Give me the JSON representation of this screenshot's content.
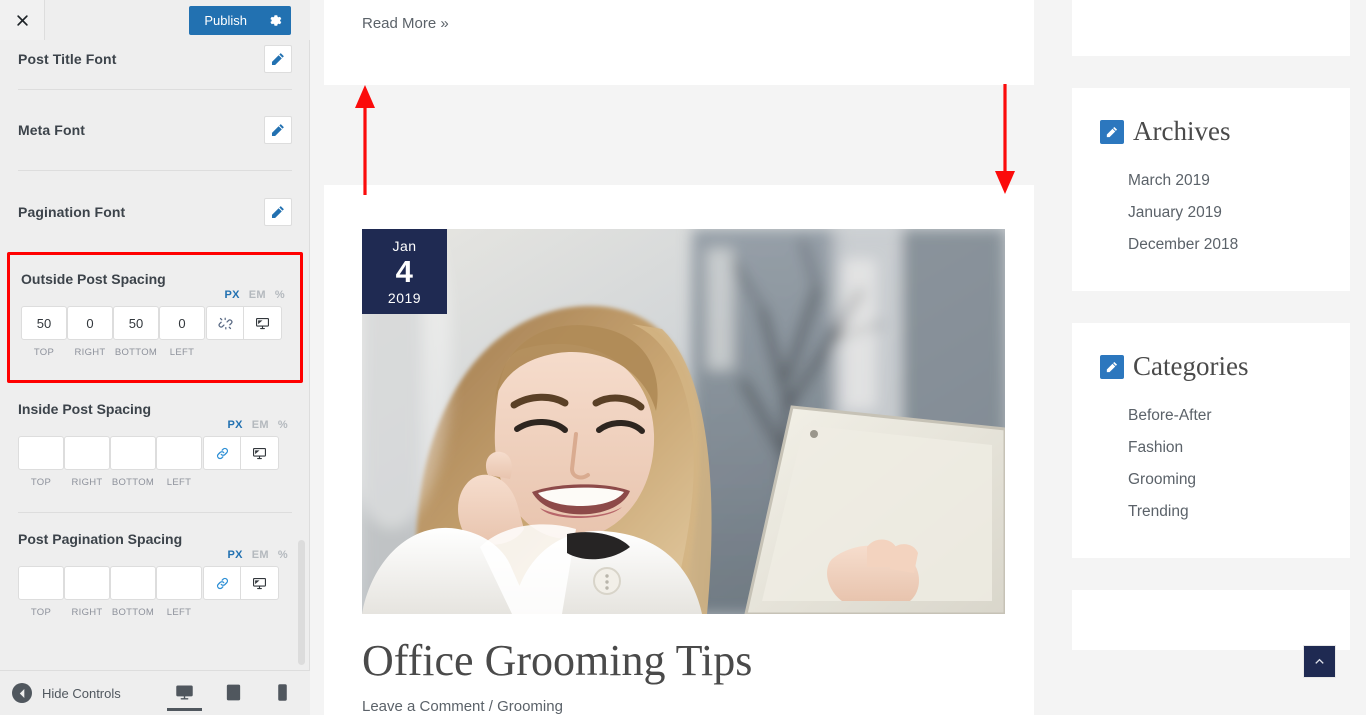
{
  "customizer": {
    "close_label": "Close customizer",
    "publish_label": "Publish",
    "gear_label": "Publish settings",
    "hide_controls_label": "Hide Controls",
    "devices": [
      {
        "name": "desktop",
        "label": "Desktop",
        "active": true
      },
      {
        "name": "tablet",
        "label": "Tablet",
        "active": false
      },
      {
        "name": "mobile",
        "label": "Mobile",
        "active": false
      }
    ],
    "font_rows": [
      {
        "label": "Post Title Font",
        "edit": "edit-icon"
      },
      {
        "label": "Meta Font",
        "edit": "edit-icon"
      },
      {
        "label": "Pagination Font",
        "edit": "edit-icon"
      }
    ],
    "spacing_groups": [
      {
        "title": "Outside Post Spacing",
        "units": [
          "PX",
          "EM",
          "%"
        ],
        "active_unit": "PX",
        "values": {
          "top": "50",
          "right": "0",
          "bottom": "50",
          "left": "0"
        },
        "sub_labels": {
          "top": "TOP",
          "right": "RIGHT",
          "bottom": "BOTTOM",
          "left": "LEFT"
        },
        "link_icon": "broken-link-icon",
        "link_state": "unlinked",
        "device_icon": "monitor-icon",
        "highlighted": true
      },
      {
        "title": "Inside Post Spacing",
        "units": [
          "PX",
          "EM",
          "%"
        ],
        "active_unit": "PX",
        "values": {
          "top": "",
          "right": "",
          "bottom": "",
          "left": ""
        },
        "sub_labels": {
          "top": "TOP",
          "right": "RIGHT",
          "bottom": "BOTTOM",
          "left": "LEFT"
        },
        "link_icon": "link-icon",
        "link_state": "linked",
        "device_icon": "monitor-icon",
        "highlighted": false
      },
      {
        "title": "Post Pagination Spacing",
        "units": [
          "PX",
          "EM",
          "%"
        ],
        "active_unit": "PX",
        "values": {
          "top": "",
          "right": "",
          "bottom": "",
          "left": ""
        },
        "sub_labels": {
          "top": "TOP",
          "right": "RIGHT",
          "bottom": "BOTTOM",
          "left": "LEFT"
        },
        "link_icon": "link-icon",
        "link_state": "linked",
        "device_icon": "monitor-icon",
        "highlighted": false
      }
    ]
  },
  "preview": {
    "previous_post": {
      "read_more_label": "Read More »"
    },
    "post": {
      "date": {
        "month": "Jan",
        "day": "4",
        "year": "2019"
      },
      "title": "Office Grooming Tips",
      "meta": "Leave a Comment / Grooming",
      "featured_image_alt": "Smiling woman in white coat holding a tablet outdoors"
    },
    "sidebar": {
      "widgets": [
        {
          "title": "Archives",
          "edit_icon": "edit-icon",
          "items": [
            "March 2019",
            "January 2019",
            "December 2018"
          ]
        },
        {
          "title": "Categories",
          "edit_icon": "edit-icon",
          "items": [
            "Before-After",
            "Fashion",
            "Grooming",
            "Trending"
          ]
        }
      ]
    },
    "scroll_top_label": "Back to top"
  },
  "annotations": {
    "arrow_up": "red-arrow-up",
    "arrow_down": "red-arrow-down",
    "highlight_box": "red-highlight-box"
  },
  "colors": {
    "accent_blue": "#2271b1",
    "widget_blue": "#2c77be",
    "navy": "#1f2a52",
    "annotation_red": "#ff0000",
    "panel_bg": "#eeeeee",
    "preview_bg": "#f4f4f4"
  }
}
